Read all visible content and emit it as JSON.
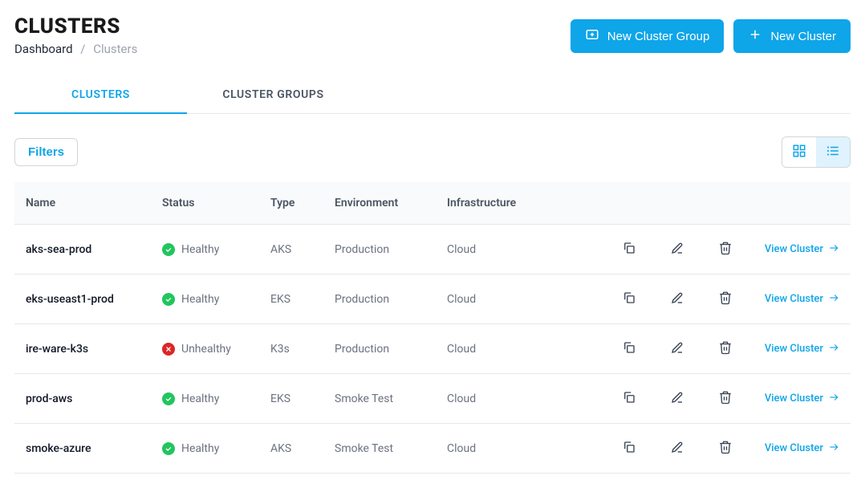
{
  "header": {
    "title": "CLUSTERS",
    "breadcrumb": {
      "root": "Dashboard",
      "current": "Clusters"
    },
    "buttons": {
      "new_group": "New Cluster Group",
      "new_cluster": "New Cluster"
    }
  },
  "tabs": [
    {
      "label": "CLUSTERS",
      "active": true
    },
    {
      "label": "CLUSTER GROUPS",
      "active": false
    }
  ],
  "toolbar": {
    "filters_label": "Filters",
    "view_mode": "list"
  },
  "table": {
    "columns": {
      "name": "Name",
      "status": "Status",
      "type": "Type",
      "environment": "Environment",
      "infrastructure": "Infrastructure"
    },
    "view_link_label": "View Cluster",
    "status_labels": {
      "healthy": "Healthy",
      "unhealthy": "Unhealthy"
    },
    "rows": [
      {
        "name": "aks-sea-prod",
        "status": "healthy",
        "type": "AKS",
        "environment": "Production",
        "infrastructure": "Cloud"
      },
      {
        "name": "eks-useast1-prod",
        "status": "healthy",
        "type": "EKS",
        "environment": "Production",
        "infrastructure": "Cloud"
      },
      {
        "name": "ire-ware-k3s",
        "status": "unhealthy",
        "type": "K3s",
        "environment": "Production",
        "infrastructure": "Cloud"
      },
      {
        "name": "prod-aws",
        "status": "healthy",
        "type": "EKS",
        "environment": "Smoke Test",
        "infrastructure": "Cloud"
      },
      {
        "name": "smoke-azure",
        "status": "healthy",
        "type": "AKS",
        "environment": "Smoke Test",
        "infrastructure": "Cloud"
      }
    ]
  }
}
